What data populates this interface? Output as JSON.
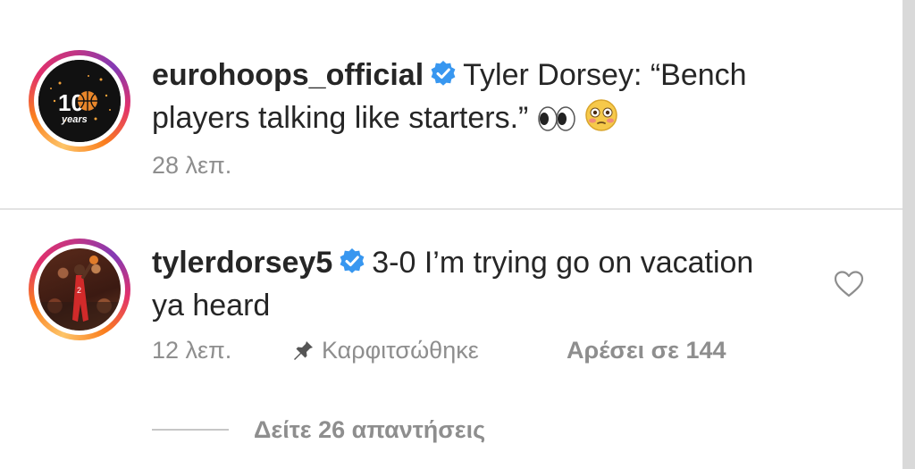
{
  "post": {
    "username": "eurohoops_official",
    "caption_line1": "Tyler Dorsey: “Bench",
    "caption_line2": "players talking like starters.”",
    "avatar_badge_big": "10",
    "avatar_badge_small": "years",
    "time": "28 λεπ."
  },
  "comment": {
    "username": "tylerdorsey5",
    "text_line1": "3-0 I’m trying go on vacation",
    "text_line2": "ya heard",
    "time": "12 λεπ.",
    "pinned_label": "Καρφιτσώθηκε",
    "likes_label": "Αρέσει σε 144",
    "view_replies": "Δείτε 26 απαντήσεις"
  },
  "icons": {
    "verified": "verified-badge-icon",
    "eyes": "eyes-emoji-icon",
    "flushed": "flushed-face-emoji-icon",
    "heart": "heart-outline-icon",
    "pin": "pin-icon"
  },
  "colors": {
    "verified_blue": "#3897f0",
    "meta_gray": "#8e8e8e",
    "text": "#262626"
  }
}
